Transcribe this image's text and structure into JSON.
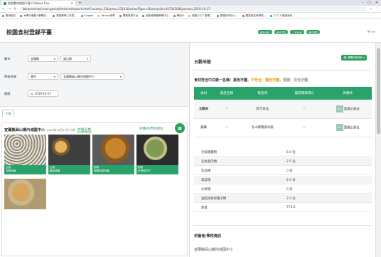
{
  "browser": {
    "tab_title": "校園食材登錄平臺 Campus Foo...",
    "url": "fatraceschool.moe.gov.tw/frontend/search.html?county=21&area=13141&schoolType=9&schoolid=64736308&period=2019-10-17",
    "bookmarks": [
      "應用程式",
      "★學行事曆+學期評...",
      "雲端教學工作表...",
      "Google",
      "Yahoo!奇摩",
      "專題資源平台",
      "客家語網路教學中心",
      "學術卡",
      "韓國 12/7 辦理...",
      "雲端科研中心...",
      "雲嘉南技術學院...",
      "127 人事處系統..."
    ]
  },
  "header": {
    "title": "校園食材登錄平臺",
    "buttons": [
      "最新消息",
      "數據下載",
      "工作計畫",
      "學校專區"
    ],
    "lang": "中 / ≡"
  },
  "filter": {
    "county_label": "縣市",
    "county_value": "宜蘭縣",
    "area_value": "員山鄉",
    "school_label": "學校名稱",
    "school_type": "國中",
    "school_value": "宜蘭縣員山鄉內城國中小",
    "date_label": "期間",
    "date_value": "2019-10-17"
  },
  "menu_tab": "午餐",
  "school": {
    "name": "宜蘭縣員山鄉內城國中小",
    "date": "2019年10月17日 午餐",
    "detail_link": "供餐型態",
    "supplier_link": "供應商/學校廚房"
  },
  "dishes": [
    {
      "type": "主食",
      "name": "五穀米飯"
    },
    {
      "type": "主菜",
      "name": "番茄燒雞"
    },
    {
      "type": "副菜",
      "name": "咖哩洋蔥時蔬"
    },
    {
      "type": "副菜",
      "name": "炒青椒豆干"
    },
    {
      "type": "",
      "name": ""
    }
  ],
  "detail": {
    "dish_name": "五穀米飯",
    "export_button": "🖨 請購料單資訊 ▾",
    "legend_lead": "食材符合中文統一名稱：",
    "legend_green": "黑色字體",
    "legend_sep1": "，不符合：",
    "legend_orange": "橘色字體",
    "legend_sep2": "，營養：",
    "legend_gray": "灰色字體",
    "table_headers": [
      "食材",
      "產品名稱",
      "製造商",
      "驗證標章或Q",
      "供應商"
    ],
    "ingredients": [
      {
        "name": "五穀米",
        "product": "—",
        "maker": "歐元食品",
        "cert": "—",
        "supplier": "寰豐企業社"
      },
      {
        "name": "白米",
        "product": "—",
        "maker": "冬山鄉農會米廠",
        "cert": "—",
        "supplier": "寰豐企業社"
      }
    ],
    "nutrition": [
      {
        "label": "全穀雜糧類",
        "value": "6.0 份"
      },
      {
        "label": "豆魚蛋肉類",
        "value": "2.5 份"
      },
      {
        "label": "乳品類",
        "value": "0 份"
      },
      {
        "label": "蔬菜類",
        "value": "2.0 份"
      },
      {
        "label": "水果類",
        "value": "0 份"
      },
      {
        "label": "油脂與堅果種子類",
        "value": "2.5 份"
      },
      {
        "label": "熱量",
        "value": "770.0"
      }
    ],
    "supplier_section": "供餐者/學校資訊",
    "supplier_name": "宜蘭縣員山鄉內城國中小"
  }
}
